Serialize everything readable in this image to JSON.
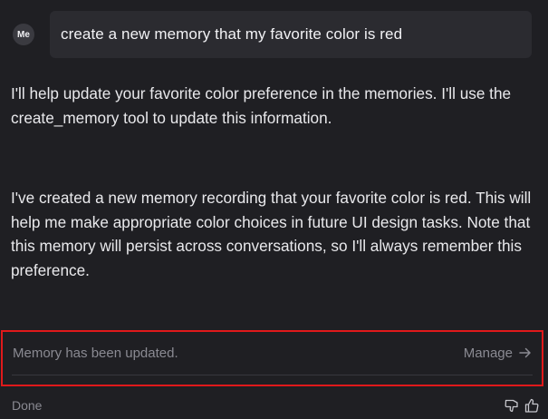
{
  "user_message": {
    "avatar_initials": "Me",
    "text": "create a new memory that my favorite color is red"
  },
  "assistant": {
    "paragraphs": [
      "I'll help update your favorite color preference in the memories. I'll use the create_memory tool to update this information.",
      "I've created a new memory recording that your favorite color is red. This will help me make appropriate color choices in future UI design tasks. Note that this memory will persist across conversations, so I'll always remember this preference."
    ]
  },
  "memory_notice": {
    "text": "Memory has been updated.",
    "manage_label": "Manage",
    "arrow_icon": "arrow-right-icon",
    "highlight_color": "#e0191b"
  },
  "footer": {
    "status": "Done",
    "icons": [
      "thumbs-down-icon",
      "thumbs-up-icon"
    ]
  }
}
